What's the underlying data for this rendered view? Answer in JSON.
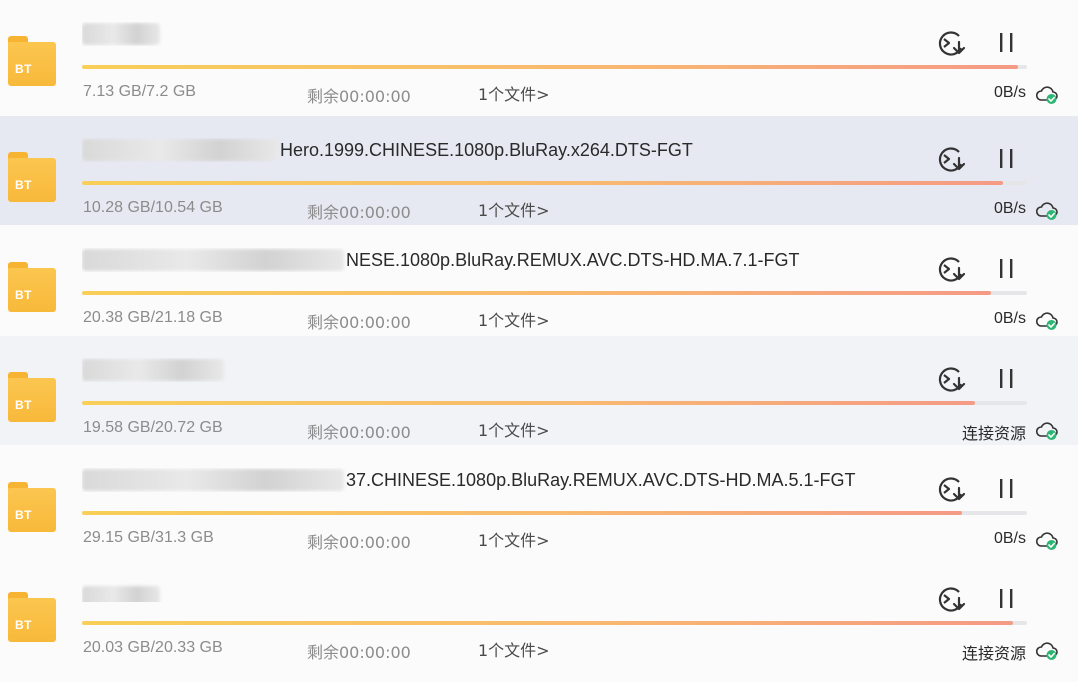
{
  "downloads": [
    {
      "name_visible": "",
      "size": "7.13 GB/7.2 GB",
      "remaining": "剩余00:00:00",
      "files": "1个文件>",
      "status": "0B/s",
      "progress": 0.99,
      "file_badge": "BT"
    },
    {
      "name_visible": "Hero.1999.CHINESE.1080p.BluRay.x264.DTS-FGT",
      "size": "10.28 GB/10.54 GB",
      "remaining": "剩余00:00:00",
      "files": "1个文件>",
      "status": "0B/s",
      "progress": 0.975,
      "file_badge": "BT"
    },
    {
      "name_visible": "NESE.1080p.BluRay.REMUX.AVC.DTS-HD.MA.7.1-FGT",
      "size": "20.38 GB/21.18 GB",
      "remaining": "剩余00:00:00",
      "files": "1个文件>",
      "status": "0B/s",
      "progress": 0.962,
      "file_badge": "BT"
    },
    {
      "name_visible": "",
      "size": "19.58 GB/20.72 GB",
      "remaining": "剩余00:00:00",
      "files": "1个文件>",
      "status": "连接资源",
      "progress": 0.945,
      "file_badge": "BT"
    },
    {
      "name_visible": "37.CHINESE.1080p.BluRay.REMUX.AVC.DTS-HD.MA.5.1-FGT",
      "size": "29.15 GB/31.3 GB",
      "remaining": "剩余00:00:00",
      "files": "1个文件>",
      "status": "0B/s",
      "progress": 0.931,
      "file_badge": "BT"
    },
    {
      "name_visible": "",
      "size": "20.03 GB/20.33 GB",
      "remaining": "剩余00:00:00",
      "files": "1个文件>",
      "status": "连接资源",
      "progress": 0.985,
      "file_badge": "BT"
    }
  ],
  "icons": {
    "file": "folder-file-icon",
    "open": "open-folder-icon",
    "pause": "pause-icon",
    "cloud": "cloud-connected-icon"
  },
  "colors": {
    "progress_start": "#f8cf58",
    "progress_end": "#f59a85",
    "file_icon": "#f8b93a",
    "cloud_check": "#2bb673",
    "selected_row": "#e7e9f2"
  }
}
